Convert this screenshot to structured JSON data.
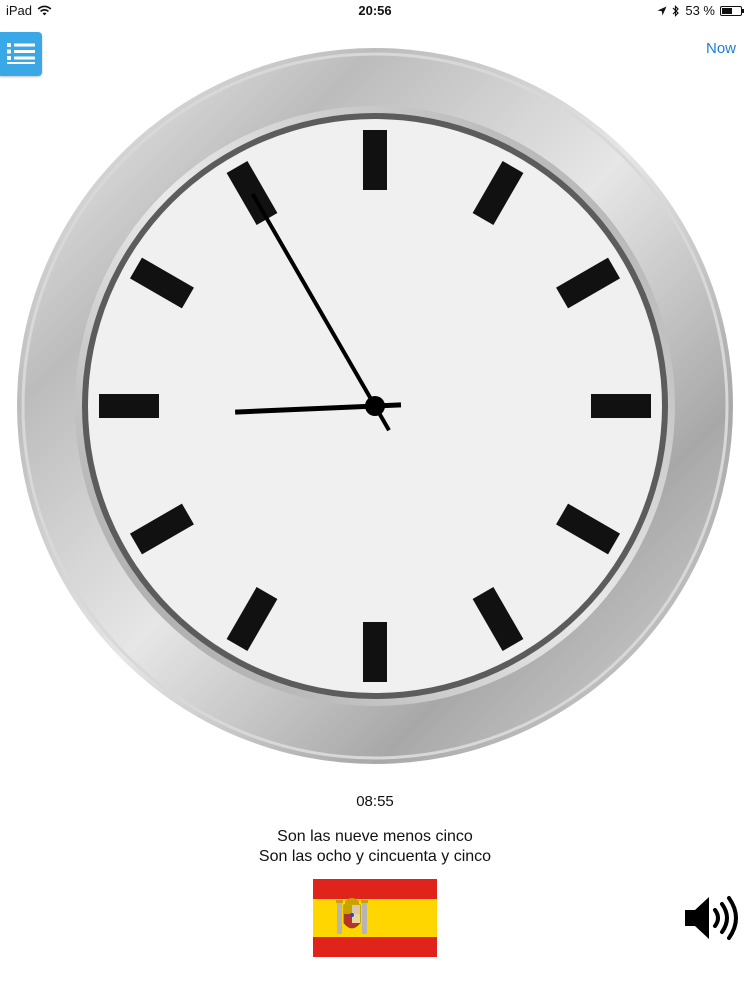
{
  "status_bar": {
    "device": "iPad",
    "time": "20:56",
    "battery": "53 %",
    "battery_level": 0.53
  },
  "toolbar": {
    "now_label": "Now",
    "menu_icon": "list-icon"
  },
  "clock": {
    "hour": 8,
    "minute": 55,
    "face_color": "#f0f0f0",
    "hand_color": "#000000"
  },
  "time_display": {
    "digital": "08:55",
    "phrase_1": "Son las nueve menos cinco",
    "phrase_2": "Son las ocho y cincuenta y cinco"
  },
  "language": {
    "flag_icon": "spain-flag-icon",
    "flag_colors": {
      "red": "#e1241b",
      "yellow": "#ffd600"
    }
  },
  "audio": {
    "icon": "speaker-icon"
  },
  "colors": {
    "accent": "#1a7fd6",
    "menu_bg": "#3aa8e6"
  }
}
